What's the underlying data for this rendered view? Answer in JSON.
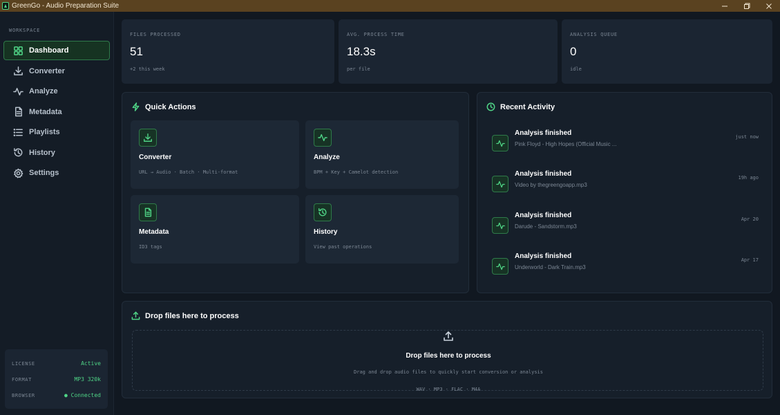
{
  "window": {
    "title": "GreenGo - Audio Preparation Suite"
  },
  "sidebar": {
    "section_label": "WORKSPACE",
    "items": [
      {
        "label": "Dashboard",
        "icon": "grid-icon",
        "active": true
      },
      {
        "label": "Converter",
        "icon": "download-icon"
      },
      {
        "label": "Analyze",
        "icon": "waveform-icon"
      },
      {
        "label": "Metadata",
        "icon": "document-icon"
      },
      {
        "label": "Playlists",
        "icon": "list-icon"
      },
      {
        "label": "History",
        "icon": "history-icon"
      },
      {
        "label": "Settings",
        "icon": "gear-icon"
      }
    ],
    "status": {
      "license_label": "LICENSE",
      "license_value": "Active",
      "format_label": "FORMAT",
      "format_value": "MP3 320k",
      "browser_label": "BROWSER",
      "browser_value": "● Connected"
    }
  },
  "stats": [
    {
      "label": "FILES PROCESSED",
      "value": "51",
      "sub": "+2 this week"
    },
    {
      "label": "AVG. PROCESS TIME",
      "value": "18.3s",
      "sub": "per file"
    },
    {
      "label": "ANALYSIS QUEUE",
      "value": "0",
      "sub": "idle"
    }
  ],
  "quick_actions": {
    "title": "Quick Actions",
    "cards": [
      {
        "title": "Converter",
        "desc": "URL → Audio · Batch · Multi-format",
        "icon": "download-icon"
      },
      {
        "title": "Analyze",
        "desc": "BPM + Key + Camelot detection",
        "icon": "waveform-icon"
      },
      {
        "title": "Metadata",
        "desc": "ID3 tags",
        "icon": "document-icon"
      },
      {
        "title": "History",
        "desc": "View past operations",
        "icon": "history-icon"
      }
    ]
  },
  "recent_activity": {
    "title": "Recent Activity",
    "items": [
      {
        "title": "Analysis finished",
        "file": "Pink Floyd - High Hopes (Official Music ...",
        "time": "just now"
      },
      {
        "title": "Analysis finished",
        "file": "Video by thegreengoapp.mp3",
        "time": "19h ago"
      },
      {
        "title": "Analysis finished",
        "file": "Darude - Sandstorm.mp3",
        "time": "Apr 20"
      },
      {
        "title": "Analysis finished",
        "file": "Underworld - Dark Train.mp3",
        "time": "Apr 17"
      }
    ]
  },
  "dropzone": {
    "header": "Drop files here to process",
    "title": "Drop files here to process",
    "desc": "Drag and drop audio files to quickly start conversion or analysis",
    "formats": "WAV · MP3 · FLAC · M4A"
  },
  "colors": {
    "accent": "#4fd486",
    "background": "#111821",
    "titlebar": "#5a4220"
  }
}
